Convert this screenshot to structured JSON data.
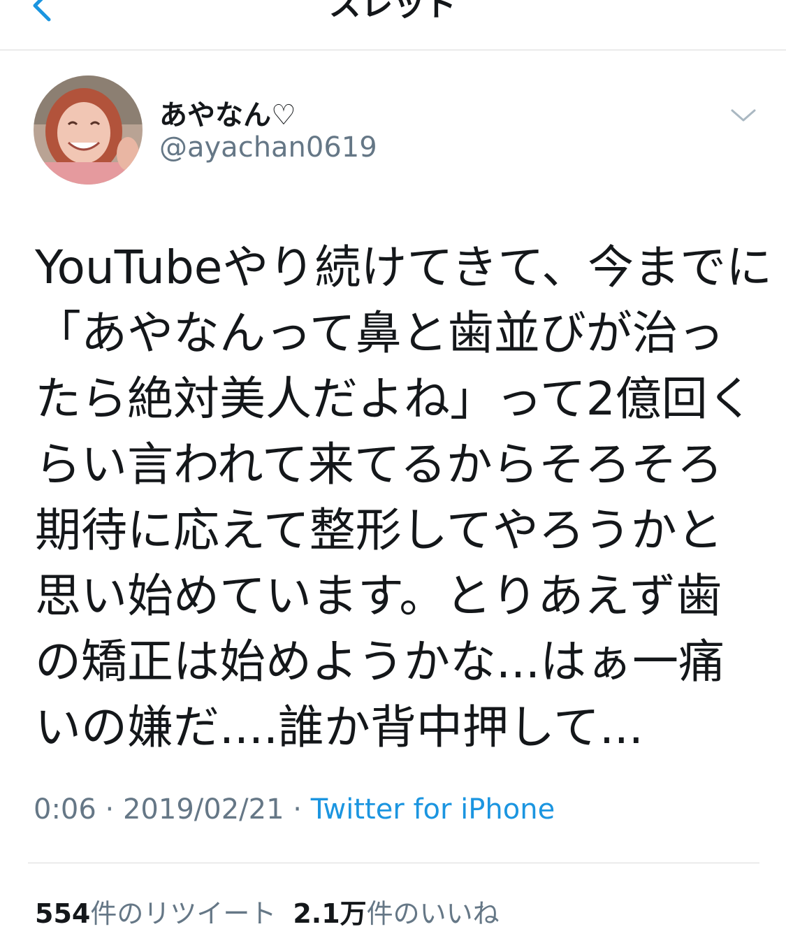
{
  "nav": {
    "title": "スレッド"
  },
  "user": {
    "display_name": "あやなん♡",
    "handle": "@ayachan0619"
  },
  "tweet": {
    "lines": [
      "YouTubeやり続けてきて、今までに",
      "「あやなんって鼻と歯並びが治っ",
      "たら絶対美人だよね」って2億回く",
      "らい言われて来てるからそろそろ",
      "期待に応えて整形してやろうかと",
      "思い始めています。とりあえず歯",
      "の矯正は始めようかな...はぁ一痛",
      "いの嫌だ....誰か背中押して..."
    ],
    "time": "0:06",
    "separator": "·",
    "date": "2019/02/21",
    "source": "Twitter for iPhone"
  },
  "stats": {
    "retweets_count": "554",
    "retweets_label": "件のリツイート",
    "likes_count": "2.1万",
    "likes_label": "件のいいね"
  },
  "colors": {
    "accent": "#1b95e0",
    "secondary_text": "#657786",
    "text": "#14171a"
  },
  "icons": [
    "back-chevron-icon",
    "more-chevron-down-icon"
  ]
}
